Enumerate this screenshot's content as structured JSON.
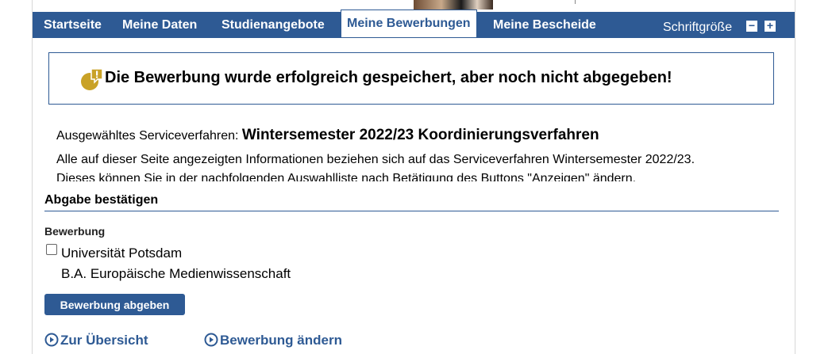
{
  "nav": {
    "items": [
      {
        "label": "Startseite"
      },
      {
        "label": "Meine Daten"
      },
      {
        "label": "Studienangebote"
      },
      {
        "label": "Meine Bewerbungen",
        "active": true
      },
      {
        "label": "Meine Bescheide"
      }
    ],
    "font_size_label": "Schriftgröße",
    "decrease_label": "−",
    "increase_label": "+"
  },
  "alert": {
    "icon": "warning-bubble-icon",
    "message": "Die Bewerbung wurde erfolgreich gespeichert, aber noch nicht abgegeben!"
  },
  "info": {
    "selected_label": "Ausgewähltes Serviceverfahren:",
    "selected_value": "Wintersemester 2022/23 Koordinierungsverfahren",
    "line1": "Alle auf dieser Seite angezeigten Informationen beziehen sich auf das Serviceverfahren Wintersemester 2022/23.",
    "line2": "Dieses können Sie in der nachfolgenden Auswahlliste nach Betätigung des Buttons \"Anzeigen\" ändern."
  },
  "confirm": {
    "title": "Abgabe bestätigen",
    "application_label": "Bewerbung",
    "university": "Universität Potsdam",
    "course": "B.A. Europäische Medienwissenschaft",
    "checked": false,
    "submit_label": "Bewerbung abgeben"
  },
  "links": {
    "overview": "Zur Übersicht",
    "edit": "Bewerbung ändern",
    "icon": "circle-play-icon"
  },
  "colors": {
    "primary": "#2e5a94",
    "alert_icon": "#c9a227"
  }
}
